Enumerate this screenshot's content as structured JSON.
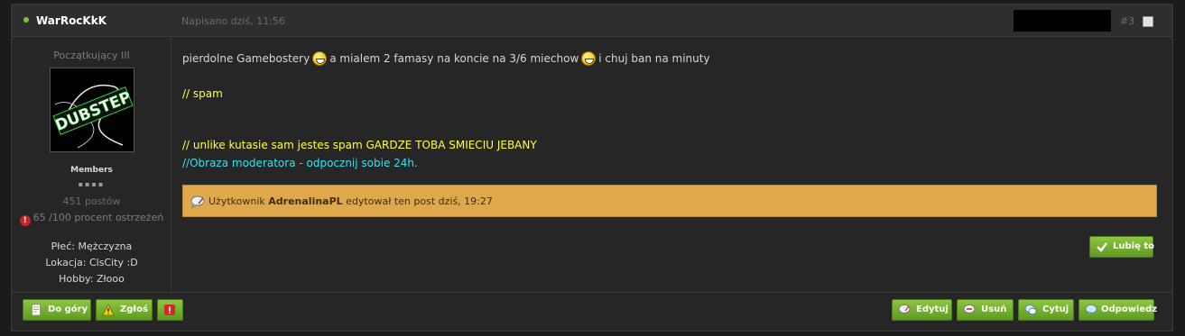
{
  "post": {
    "author": "WarRocKkK",
    "date": "Napisano dziś, 11:56",
    "number": "#3"
  },
  "author_panel": {
    "rank": "Początkujący III",
    "avatar_text": "DUBSTEP",
    "group": "Members",
    "pips": "▪▪▪▪",
    "post_count": "451 postów",
    "warnings": "65 /100 procent ostrzeżeń",
    "gender": "Płeć: Mężczyzna",
    "location": "Lokacja: ClsCity :D",
    "hobby": "Hobby: Złooo"
  },
  "body": {
    "line1_a": "pierdolne Gamebostery",
    "line1_b": "a mialem 2 famasy na koncie na 3/6 miechow",
    "line1_c": "i chuj ban na minuty",
    "line2": "// spam",
    "line3": "// unlike kutasie sam jestes spam GARDZE TOBA SMIECIU JEBANY",
    "line4": "//Obraza moderatora - odpocznij sobie 24h."
  },
  "edit_note": {
    "prefix": "Użytkownik",
    "user": "AdrenalinaPL",
    "suffix": "edytował ten post dziś, 19:27"
  },
  "buttons": {
    "like": "Lubię to",
    "top": "Do góry",
    "report": "Zgłoś",
    "edit": "Edytuj",
    "delete": "Usuń",
    "quote": "Cytuj",
    "reply": "Odpowiedz"
  },
  "colors": {
    "accent_green": "#6fae2e",
    "online": "#78c440",
    "edit_box": "#dfa84a",
    "spam_note": "#ffff3b",
    "mod_note": "#34e2f0"
  },
  "icons": [
    "online-dot",
    "warning-icon",
    "smiley-icon",
    "edit-speech-icon",
    "check-icon",
    "document-icon",
    "alert-triangle-icon",
    "exclamation-icon",
    "trash-icon",
    "quote-icon",
    "reply-icon"
  ]
}
